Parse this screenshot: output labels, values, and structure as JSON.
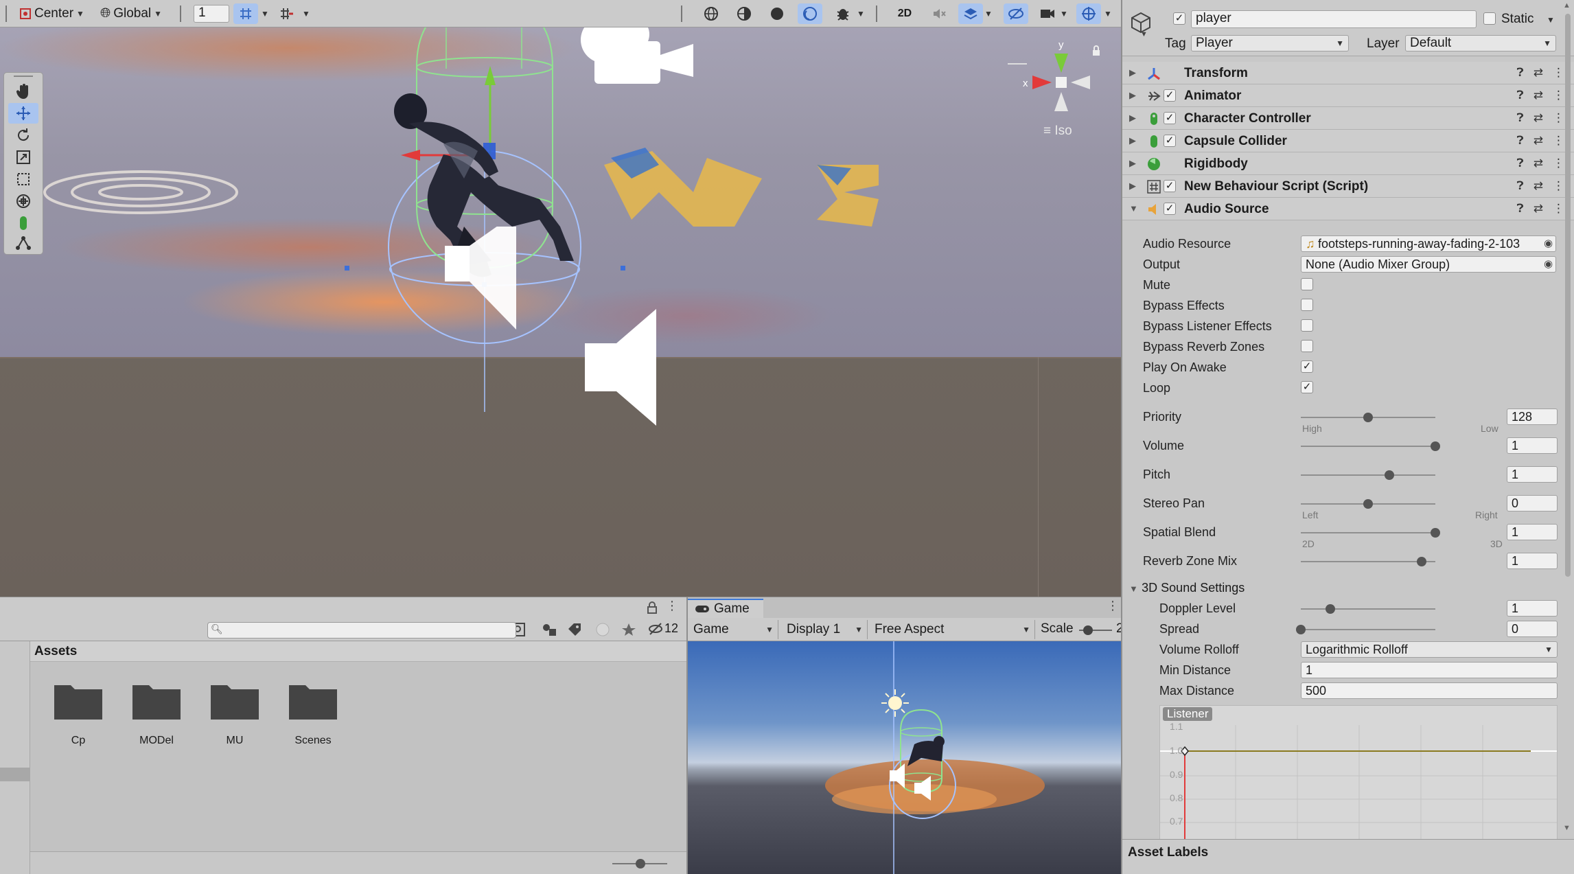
{
  "scene_toolbar": {
    "pivot_label": "Center",
    "space_label": "Global",
    "grid_value": "1",
    "mode_2d_label": "2D"
  },
  "scene_view": {
    "iso_label": "Iso",
    "gizmo_y": "y",
    "gizmo_x": "x"
  },
  "project": {
    "assets_title": "Assets",
    "hidden_count": "12",
    "folders": [
      "Cp",
      "MODel",
      "MU",
      "Scenes"
    ]
  },
  "game": {
    "tab_label": "Game",
    "view_dropdown": "Game",
    "display_dropdown": "Display 1",
    "aspect_dropdown": "Free Aspect",
    "scale_label": "Scale",
    "scale_value_partial": "2"
  },
  "inspector": {
    "object_name": "player",
    "static_label": "Static",
    "tag_label": "Tag",
    "tag_value": "Player",
    "layer_label": "Layer",
    "layer_value": "Default",
    "components": [
      {
        "name": "Transform",
        "has_checkbox": false
      },
      {
        "name": "Animator",
        "has_checkbox": true
      },
      {
        "name": "Character Controller",
        "has_checkbox": true
      },
      {
        "name": "Capsule Collider",
        "has_checkbox": true
      },
      {
        "name": "Rigidbody",
        "has_checkbox": false
      },
      {
        "name": "New Behaviour Script (Script)",
        "has_checkbox": true
      },
      {
        "name": "Audio Source",
        "has_checkbox": true
      }
    ],
    "audio": {
      "audio_resource_label": "Audio Resource",
      "audio_resource_value": "footsteps-running-away-fading-2-103",
      "output_label": "Output",
      "output_value": "None (Audio Mixer Group)",
      "mute_label": "Mute",
      "bypass_effects_label": "Bypass Effects",
      "bypass_listener_label": "Bypass Listener Effects",
      "bypass_reverb_label": "Bypass Reverb Zones",
      "play_on_awake_label": "Play On Awake",
      "loop_label": "Loop",
      "mute": false,
      "bypass_effects": false,
      "bypass_listener": false,
      "bypass_reverb": false,
      "play_on_awake": true,
      "loop": true,
      "priority_label": "Priority",
      "priority_value": "128",
      "priority_fraction": 0.5,
      "priority_min": "High",
      "priority_max": "Low",
      "volume_label": "Volume",
      "volume_value": "1",
      "volume_fraction": 1.0,
      "pitch_label": "Pitch",
      "pitch_value": "1",
      "pitch_fraction": 0.66,
      "stereo_pan_label": "Stereo Pan",
      "stereo_pan_value": "0",
      "stereo_pan_fraction": 0.5,
      "stereo_min": "Left",
      "stereo_max": "Right",
      "spatial_blend_label": "Spatial Blend",
      "spatial_blend_value": "1",
      "spatial_blend_fraction": 1.0,
      "spatial_min": "2D",
      "spatial_max": "3D",
      "reverb_mix_label": "Reverb Zone Mix",
      "reverb_mix_value": "1",
      "reverb_mix_fraction": 0.9,
      "sound3d_label": "3D Sound Settings",
      "doppler_label": "Doppler Level",
      "doppler_value": "1",
      "doppler_fraction": 0.22,
      "spread_label": "Spread",
      "spread_value": "0",
      "spread_fraction": 0.0,
      "rolloff_label": "Volume Rolloff",
      "rolloff_value": "Logarithmic Rolloff",
      "min_distance_label": "Min Distance",
      "min_distance_value": "1",
      "max_distance_label": "Max Distance",
      "max_distance_value": "500",
      "listener_label": "Listener",
      "curve_ticks": [
        "1.1",
        "1.0",
        "0.9",
        "0.8",
        "0.7"
      ]
    },
    "asset_labels": "Asset Labels"
  },
  "colors": {
    "accent_blue": "#3d7ad9",
    "selected_tool": "#a9c4ef",
    "gizmo_green": "#8fe38f",
    "gizmo_blue": "#a6c3ff"
  }
}
